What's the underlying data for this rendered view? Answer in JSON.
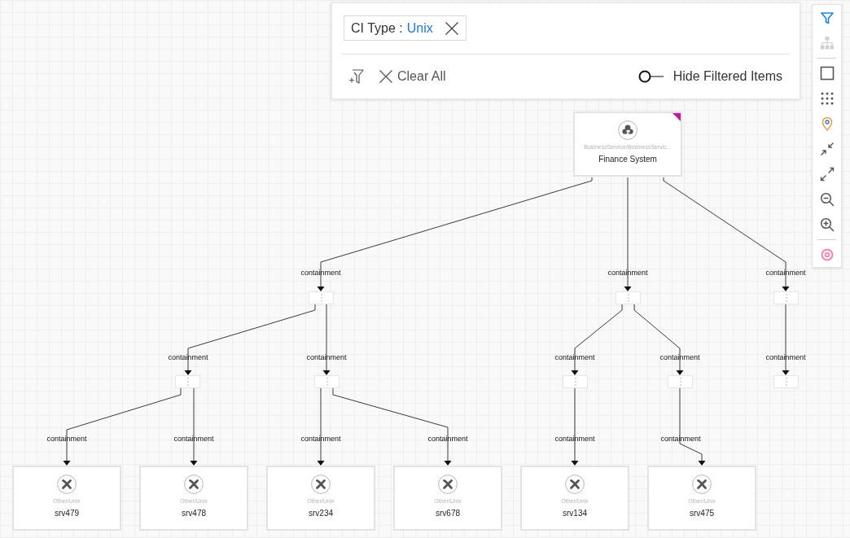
{
  "filter_panel": {
    "chips": [
      {
        "label": "CI Type :",
        "value": "Unix"
      }
    ],
    "clear_all": "Clear All",
    "hide_filtered_items": {
      "label": "Hide Filtered Items",
      "on": false
    }
  },
  "toolbar": {
    "groups": [
      {
        "items": [
          {
            "kind": "filter",
            "selected": true,
            "disabled": false
          },
          {
            "kind": "hierarchy",
            "selected": false,
            "disabled": true
          }
        ]
      },
      {
        "items": [
          {
            "kind": "square",
            "selected": false,
            "disabled": false
          },
          {
            "kind": "grid",
            "selected": false,
            "disabled": false
          },
          {
            "kind": "pin",
            "selected": false,
            "disabled": false
          },
          {
            "kind": "collapse",
            "selected": false,
            "disabled": false
          },
          {
            "kind": "expand",
            "selected": false,
            "disabled": false
          },
          {
            "kind": "zoom-out",
            "selected": false,
            "disabled": false
          },
          {
            "kind": "zoom-in",
            "selected": false,
            "disabled": false
          }
        ]
      },
      {
        "items": [
          {
            "kind": "target",
            "selected": false,
            "disabled": false
          }
        ]
      }
    ]
  },
  "graph": {
    "root": {
      "kind": "service",
      "type": "BusinessService/BusinessServic...",
      "name": "Finance System",
      "flagged": true,
      "children": [
        {
          "edge_label": "containment",
          "kind": "group",
          "children": [
            {
              "edge_label": "containment",
              "kind": "group",
              "children": [
                {
                  "edge_label": "containment",
                  "kind": "host",
                  "type": "Other/Unix",
                  "name": "srv479",
                  "flagged": false
                },
                {
                  "edge_label": "containment",
                  "kind": "host",
                  "type": "Other/Unix",
                  "name": "srv478",
                  "flagged": false
                }
              ]
            },
            {
              "edge_label": "containment",
              "kind": "group",
              "children": [
                {
                  "edge_label": "containment",
                  "kind": "host",
                  "type": "Other/Unix",
                  "name": "srv234",
                  "flagged": false
                },
                {
                  "edge_label": "containment",
                  "kind": "host",
                  "type": "Other/Unix",
                  "name": "srv678",
                  "flagged": false
                }
              ]
            }
          ]
        },
        {
          "edge_label": "containment",
          "kind": "group",
          "children": [
            {
              "edge_label": "containment",
              "kind": "group",
              "children": [
                {
                  "edge_label": "containment",
                  "kind": "host",
                  "type": "Other/Unix",
                  "name": "srv134",
                  "flagged": false
                }
              ]
            },
            {
              "edge_label": "containment",
              "kind": "group",
              "children": [
                {
                  "edge_label": "containment",
                  "kind": "host",
                  "type": "Other/Unix",
                  "name": "srv475",
                  "flagged": false
                }
              ]
            }
          ]
        },
        {
          "edge_label": "containment",
          "kind": "group",
          "children": [
            {
              "edge_label": "containment",
              "kind": "group"
            }
          ]
        }
      ]
    }
  }
}
